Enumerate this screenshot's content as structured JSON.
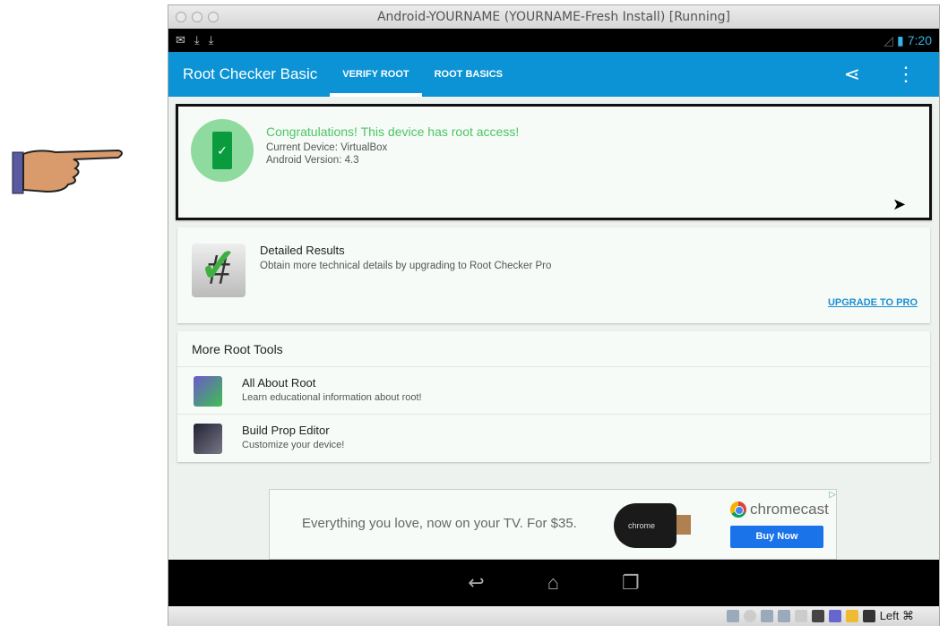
{
  "window": {
    "title": "Android-YOURNAME (YOURNAME-Fresh Install) [Running]"
  },
  "status_bar": {
    "time": "7:20",
    "icons": [
      "gmail-icon",
      "download-icon",
      "download-icon"
    ]
  },
  "app_bar": {
    "title": "Root Checker Basic",
    "tabs": [
      {
        "label": "VERIFY ROOT",
        "active": true
      },
      {
        "label": "ROOT BASICS",
        "active": false
      }
    ],
    "actions": [
      "share-icon",
      "overflow-menu-icon"
    ]
  },
  "result": {
    "headline": "Congratulations! This device has root access!",
    "device": "Current Device: VirtualBox",
    "version": "Android Version: 4.3"
  },
  "detailed": {
    "title": "Detailed Results",
    "desc": "Obtain more technical details by upgrading to Root Checker Pro",
    "upgrade": "UPGRADE TO PRO"
  },
  "tools": {
    "header": "More Root Tools",
    "items": [
      {
        "title": "All About Root",
        "desc": "Learn educational information about root!"
      },
      {
        "title": "Build Prop Editor",
        "desc": "Customize your device!"
      }
    ]
  },
  "ad": {
    "text": "Everything you love, now on your TV. For $35.",
    "dongle": "chrome",
    "brand": "chromecast",
    "cta": "Buy Now"
  },
  "vbox": {
    "host_key": "Left ⌘"
  },
  "colors": {
    "accent": "#0b93d5",
    "success": "#4cc466"
  }
}
